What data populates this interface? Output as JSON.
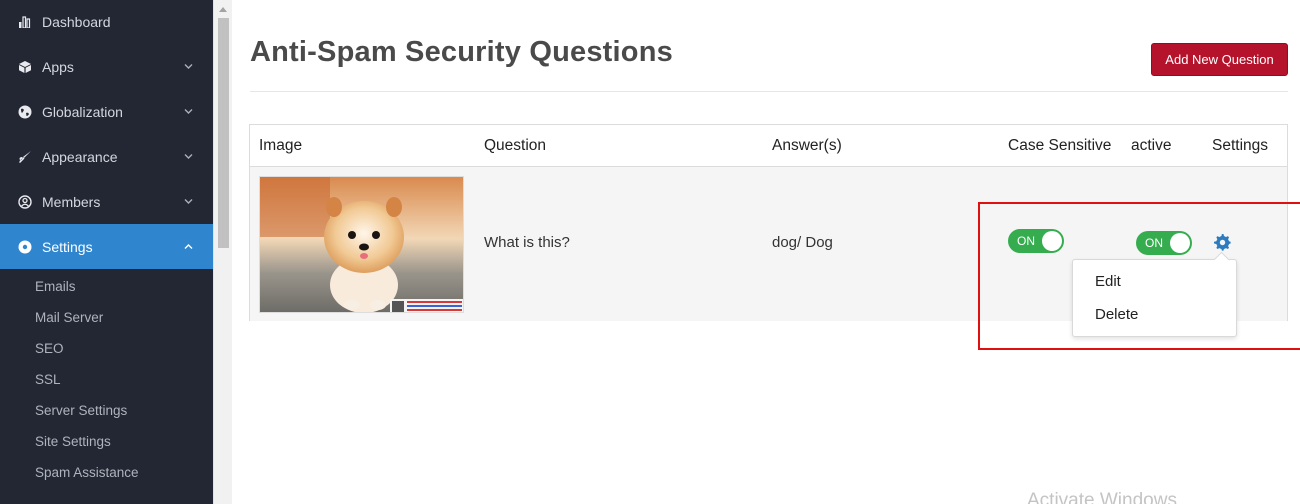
{
  "sidebar": {
    "items": [
      {
        "label": "Dashboard",
        "icon": "bar-chart-icon"
      },
      {
        "label": "Apps",
        "icon": "cube-icon"
      },
      {
        "label": "Globalization",
        "icon": "globe-icon"
      },
      {
        "label": "Appearance",
        "icon": "brush-icon"
      },
      {
        "label": "Members",
        "icon": "user-circle-icon"
      },
      {
        "label": "Settings",
        "icon": "gear-icon"
      }
    ],
    "settings_subitems": [
      "Emails",
      "Mail Server",
      "SEO",
      "SSL",
      "Server Settings",
      "Site Settings",
      "Spam Assistance"
    ]
  },
  "main": {
    "title": "Anti-Spam Security Questions",
    "add_button": "Add New Question",
    "table": {
      "headers": [
        "Image",
        "Question",
        "Answer(s)",
        "Case Sensitive",
        "active",
        "Settings"
      ],
      "rows": [
        {
          "question": "What is this?",
          "answers": "dog/ Dog",
          "case_sensitive": "ON",
          "active": "ON"
        }
      ]
    },
    "dropdown": {
      "items": [
        "Edit",
        "Delete"
      ]
    }
  },
  "watermark": "Activate Windows",
  "colors": {
    "sidebar_bg": "#222733",
    "active_nav": "#2f86cf",
    "add_button": "#b5132b",
    "toggle_on": "#35ad4f",
    "gear": "#2c7bbf",
    "highlight": "#e01010"
  }
}
